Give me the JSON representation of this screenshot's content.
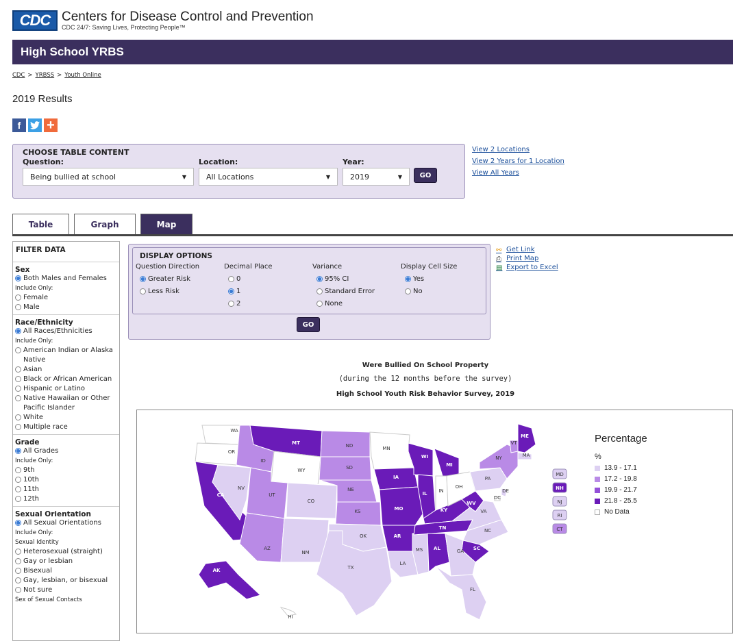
{
  "header": {
    "logo_text": "CDC",
    "org_name": "Centers for Disease Control and Prevention",
    "tagline": "CDC 24/7: Saving Lives, Protecting People™"
  },
  "banner_title": "High School YRBS",
  "breadcrumb": [
    "CDC",
    "YRBSS",
    "Youth Online"
  ],
  "page_title": "2019 Results",
  "social": {
    "facebook": "f",
    "twitter": "t",
    "share": "+"
  },
  "choose": {
    "title": "CHOOSE TABLE CONTENT",
    "question_label": "Question:",
    "question_value": "Being bullied at school",
    "location_label": "Location:",
    "location_value": "All Locations",
    "year_label": "Year:",
    "year_value": "2019",
    "go": "GO"
  },
  "side_links": [
    "View 2 Locations",
    "View 2 Years for 1 Location",
    "View All Years"
  ],
  "tabs": [
    "Table",
    "Graph",
    "Map"
  ],
  "filter": {
    "title": "FILTER DATA",
    "sex": {
      "heading": "Sex",
      "all": "Both Males and Females",
      "include": "Include Only:",
      "options": [
        "Female",
        "Male"
      ]
    },
    "race": {
      "heading": "Race/Ethnicity",
      "all": "All Races/Ethnicities",
      "include": "Include Only:",
      "options": [
        "American Indian or Alaska Native",
        "Asian",
        "Black or African American",
        "Hispanic or Latino",
        "Native Hawaiian or Other Pacific Islander",
        "White",
        "Multiple race"
      ]
    },
    "grade": {
      "heading": "Grade",
      "all": "All Grades",
      "include": "Include Only:",
      "options": [
        "9th",
        "10th",
        "11th",
        "12th"
      ]
    },
    "orientation": {
      "heading": "Sexual Orientation",
      "all": "All Sexual Orientations",
      "include": "Include Only:",
      "identity": "Sexual Identity",
      "options": [
        "Heterosexual (straight)",
        "Gay or lesbian",
        "Bisexual",
        "Gay, lesbian, or bisexual",
        "Not sure"
      ],
      "contacts": "Sex of Sexual Contacts"
    }
  },
  "display": {
    "title": "DISPLAY OPTIONS",
    "direction": {
      "label": "Question Direction",
      "options": [
        "Greater Risk",
        "Less Risk"
      ],
      "selected": 0
    },
    "decimal": {
      "label": "Decimal Place",
      "options": [
        "0",
        "1",
        "2"
      ],
      "selected": 1
    },
    "variance": {
      "label": "Variance",
      "options": [
        "95% CI",
        "Standard Error",
        "None"
      ],
      "selected": 0
    },
    "cellsize": {
      "label": "Display Cell Size",
      "options": [
        "Yes",
        "No"
      ],
      "selected": 0
    },
    "go": "GO"
  },
  "tools": [
    "Get Link",
    "Print Map",
    "Export to Excel"
  ],
  "map": {
    "title": "Were Bullied On School Property",
    "subtitle": "(during the 12 months before the survey)",
    "survey": "High School Youth Risk Behavior Survey, 2019",
    "legend_title": "Percentage",
    "legend_unit": "%",
    "legend": [
      {
        "label": "13.9 - 17.1",
        "color": "#ddd0f2"
      },
      {
        "label": "17.2 - 19.8",
        "color": "#b98ae6"
      },
      {
        "label": "19.9 - 21.7",
        "color": "#9450d8"
      },
      {
        "label": "21.8 - 25.5",
        "color": "#6a1bb8"
      },
      {
        "label": "No Data",
        "color": "#ffffff"
      }
    ],
    "small_states": [
      {
        "code": "MD",
        "color": "#ddd0f2"
      },
      {
        "code": "NH",
        "color": "#6a1bb8"
      },
      {
        "code": "NJ",
        "color": "#ddd0f2"
      },
      {
        "code": "RI",
        "color": "#ddd0f2"
      },
      {
        "code": "CT",
        "color": "#b98ae6"
      }
    ],
    "state_labels": [
      "WA",
      "OR",
      "CA",
      "NV",
      "ID",
      "MT",
      "WY",
      "UT",
      "AZ",
      "CO",
      "NM",
      "ND",
      "SD",
      "NE",
      "KS",
      "OK",
      "TX",
      "MN",
      "IA",
      "MO",
      "AR",
      "LA",
      "WI",
      "IL",
      "MS",
      "MI",
      "IN",
      "KY",
      "TN",
      "AL",
      "OH",
      "WV",
      "VA",
      "NC",
      "SC",
      "GA",
      "FL",
      "PA",
      "NY",
      "VT",
      "ME",
      "MA",
      "DE",
      "DC",
      "AK",
      "HI"
    ]
  }
}
